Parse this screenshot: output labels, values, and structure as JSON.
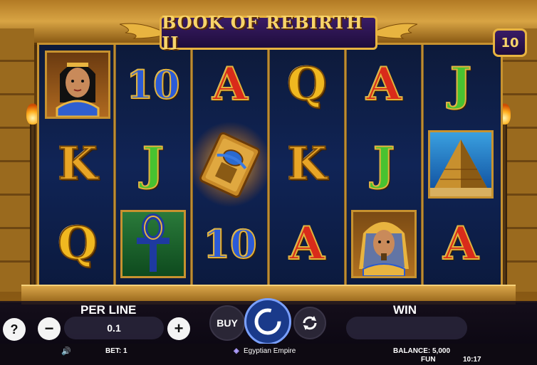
{
  "game": {
    "title": "BOOK OF REBIRTH II",
    "lines": "10"
  },
  "grid": [
    [
      "cleopatra",
      "10",
      "A",
      "Q",
      "A",
      "J"
    ],
    [
      "K",
      "J",
      "book",
      "K",
      "J",
      "pyramid"
    ],
    [
      "Q",
      "ankh",
      "10",
      "A",
      "pharaoh",
      "A"
    ]
  ],
  "controls": {
    "per_line_label": "PER LINE",
    "per_line_value": "0.1",
    "minus": "−",
    "plus": "+",
    "help": "?",
    "buy": "BUY",
    "win_label": "WIN",
    "win_value": ""
  },
  "status": {
    "bet": "BET: 1",
    "provider": "Egyptian Empire",
    "balance": "BALANCE: 5,000",
    "mode": "FUN",
    "time": "10:17"
  },
  "colors": {
    "gold": "#e8b440",
    "reel_bg": "#102456",
    "title_plate": "#3a1c66"
  }
}
